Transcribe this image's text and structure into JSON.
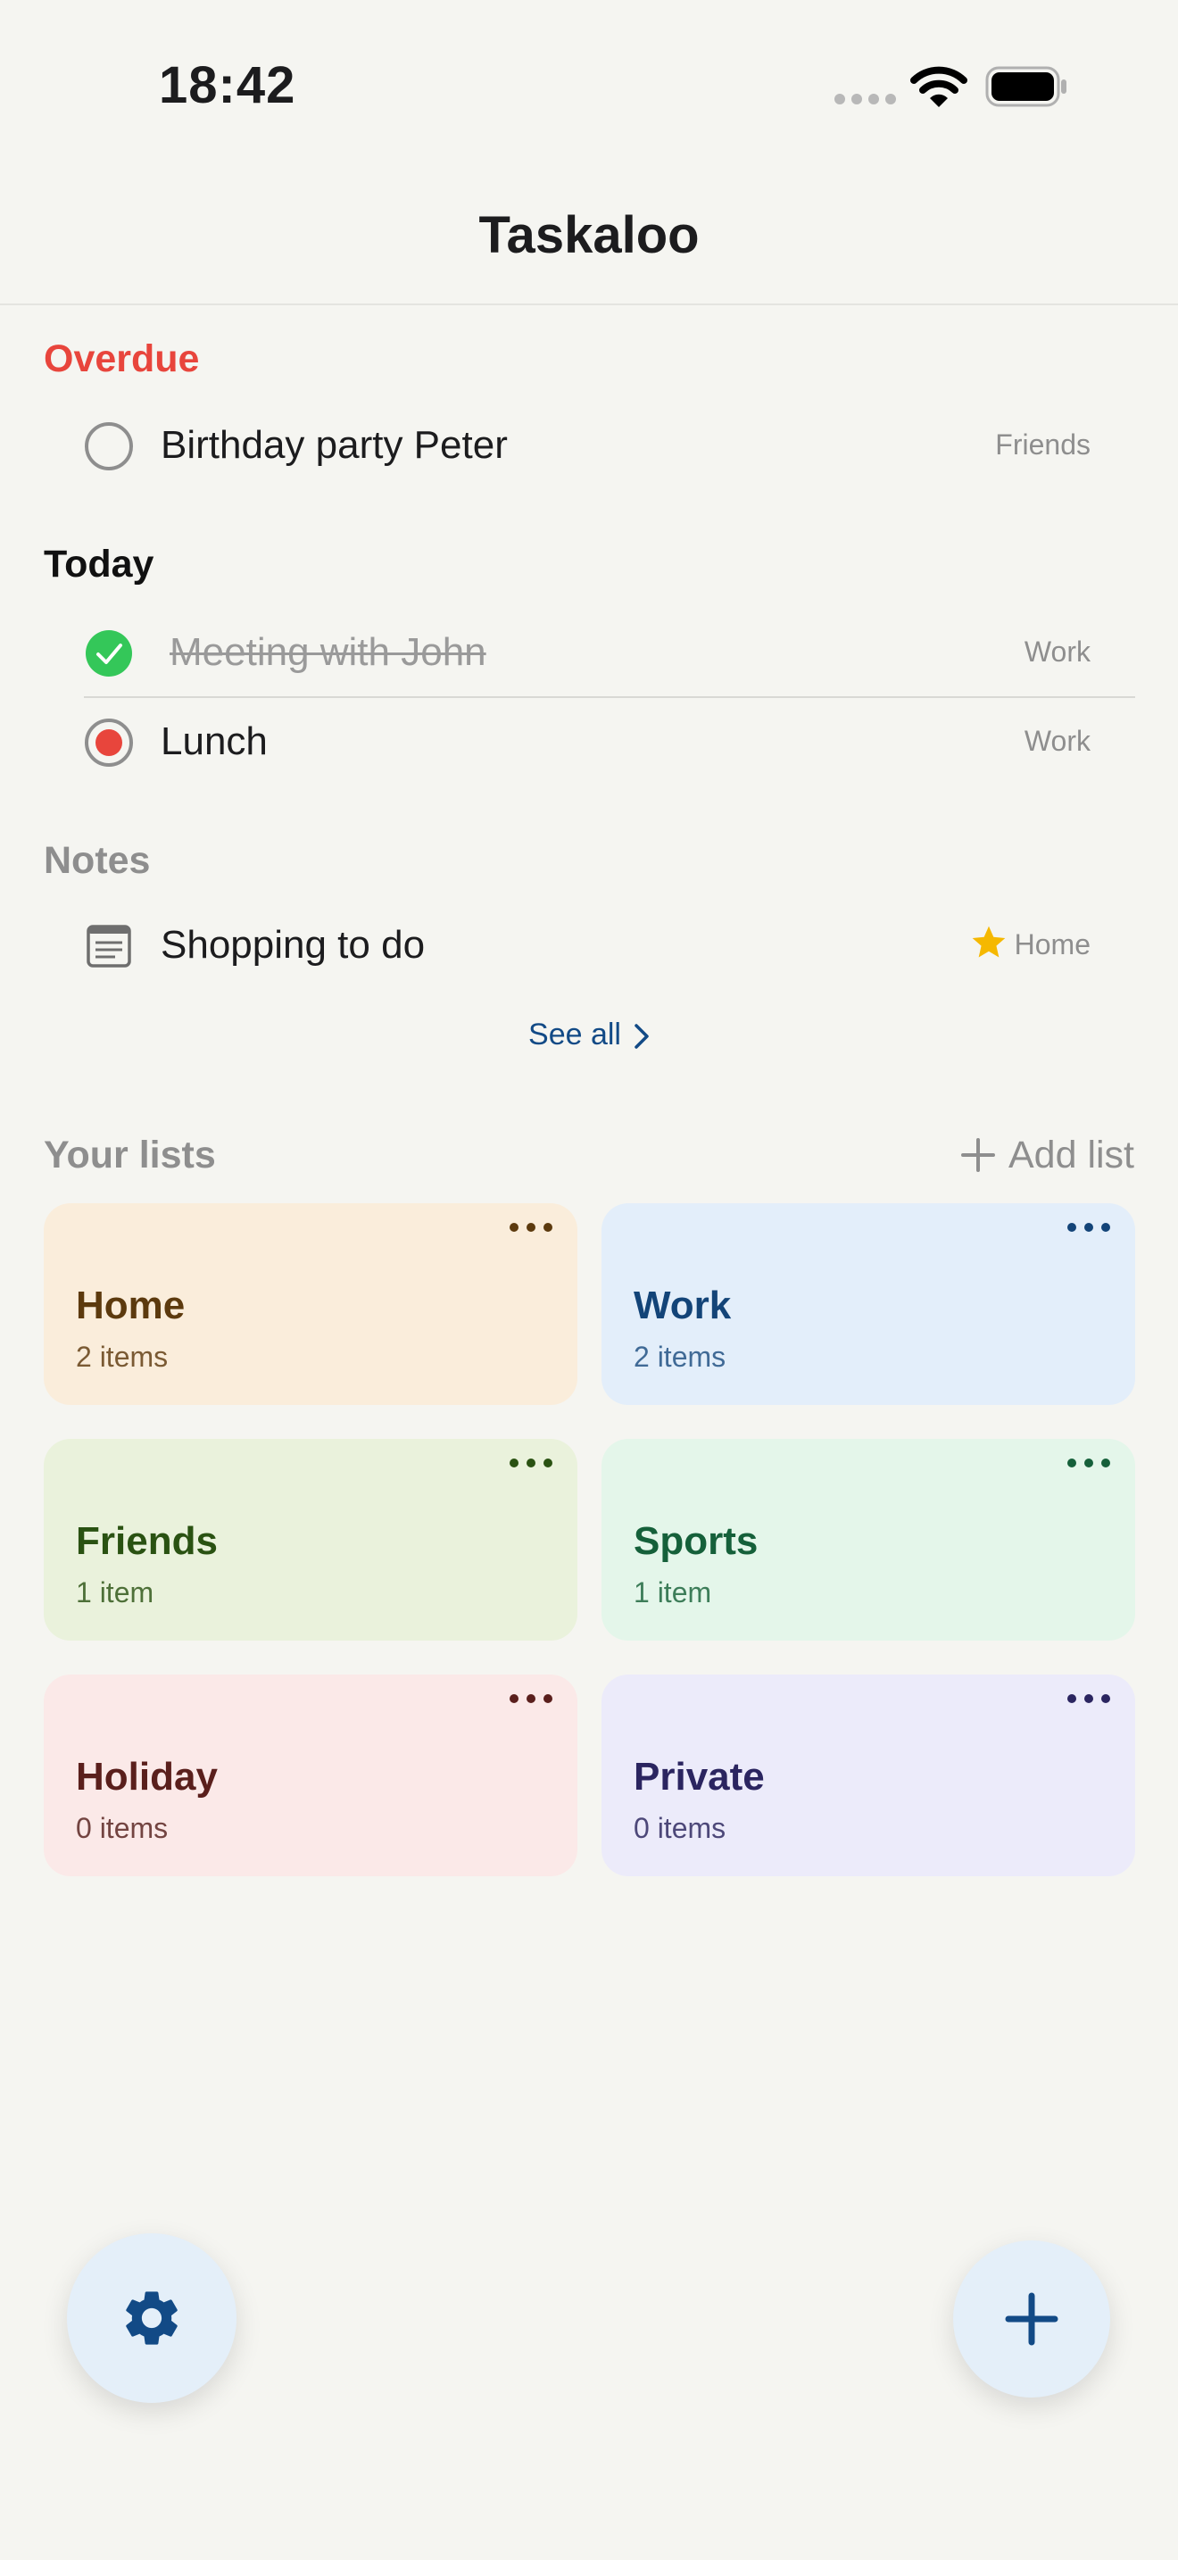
{
  "status": {
    "time": "18:42"
  },
  "app": {
    "title": "Taskaloo"
  },
  "sections": {
    "overdue": {
      "title": "Overdue",
      "items": [
        {
          "label": "Birthday party Peter",
          "tag": "Friends",
          "state": "open"
        }
      ]
    },
    "today": {
      "title": "Today",
      "items": [
        {
          "label": "Meeting with John",
          "tag": "Work",
          "state": "done"
        },
        {
          "label": "Lunch",
          "tag": "Work",
          "state": "active"
        }
      ]
    },
    "notes": {
      "title": "Notes",
      "items": [
        {
          "label": "Shopping to do",
          "tag": "Home",
          "starred": true
        }
      ]
    }
  },
  "see_all": {
    "label": "See all"
  },
  "lists": {
    "title": "Your lists",
    "add_label": "Add list",
    "cards": [
      {
        "name": "Home",
        "count": "2 items",
        "bg": "#faeddb",
        "fg": "#5c3a0e",
        "sub": "#7a5a33",
        "dots": "#5c3a0e"
      },
      {
        "name": "Work",
        "count": "2 items",
        "bg": "#e3eefa",
        "fg": "#134478",
        "sub": "#406a96",
        "dots": "#134478"
      },
      {
        "name": "Friends",
        "count": "1 item",
        "bg": "#eaf2dc",
        "fg": "#2a5212",
        "sub": "#4e7038",
        "dots": "#2a5212"
      },
      {
        "name": "Sports",
        "count": "1 item",
        "bg": "#e4f6ea",
        "fg": "#15603a",
        "sub": "#3d7d59",
        "dots": "#15603a"
      },
      {
        "name": "Holiday",
        "count": "0 items",
        "bg": "#fbe9e8",
        "fg": "#5a1f1c",
        "sub": "#734441",
        "dots": "#5a1f1c"
      },
      {
        "name": "Private",
        "count": "0 items",
        "bg": "#ecebfa",
        "fg": "#2b2560",
        "sub": "#4d4879",
        "dots": "#2b2560"
      }
    ]
  },
  "colors": {
    "accent": "#124a86",
    "overdue": "#e8453c",
    "done_green": "#34c759",
    "active_red": "#e8453c",
    "star": "#f5b800"
  },
  "icons": {
    "settings": "gear-icon",
    "add": "plus-icon"
  }
}
